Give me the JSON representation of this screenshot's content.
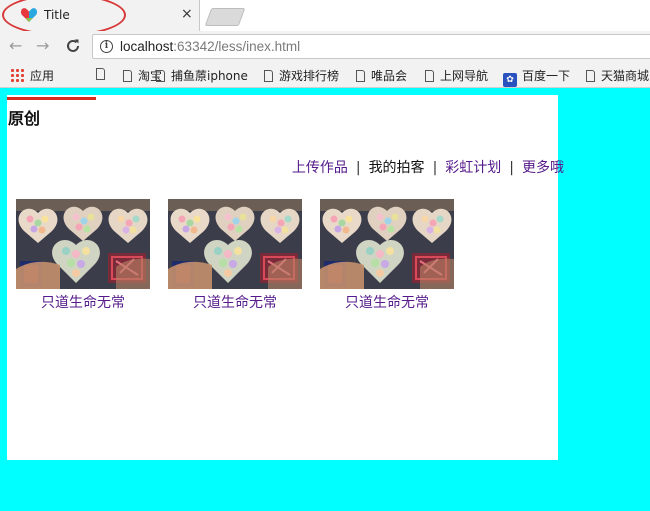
{
  "browser": {
    "tab_title": "Title",
    "tab_close": "×",
    "url_host": "localhost",
    "url_rest": ":63342/less/inex.html",
    "bookmarks": [
      {
        "label": "应用",
        "icon": "apps-icon"
      },
      {
        "label": "",
        "icon": "page-icon"
      },
      {
        "label": "淘宝",
        "icon": "page-icon"
      },
      {
        "label": "捕鱼蒝iphone",
        "icon": "page-icon"
      },
      {
        "label": "游戏排行榜",
        "icon": "page-icon"
      },
      {
        "label": "唯品会",
        "icon": "page-icon"
      },
      {
        "label": "上网导航",
        "icon": "page-icon"
      },
      {
        "label": "百度一下",
        "icon": "baidu-paw-icon"
      },
      {
        "label": "天猫商城",
        "icon": "page-icon"
      }
    ]
  },
  "page": {
    "heading": "原创",
    "nav": [
      {
        "label": "上传作品",
        "current": false
      },
      {
        "label": "我的拍客",
        "current": true
      },
      {
        "label": "彩虹计划",
        "current": false
      },
      {
        "label": "更多哦",
        "current": false
      }
    ],
    "nav_separator": "|",
    "cards": [
      {
        "caption": "只道生命无常",
        "image": "heart-box-macarons-photo"
      },
      {
        "caption": "只道生命无常",
        "image": "heart-box-macarons-photo"
      },
      {
        "caption": "只道生命无常",
        "image": "heart-box-macarons-photo"
      }
    ]
  },
  "colors": {
    "page_background": "#00ffff",
    "link_visited": "#551a8b",
    "accent_red": "#d62d20",
    "tab_highlight": "#d8393a"
  }
}
